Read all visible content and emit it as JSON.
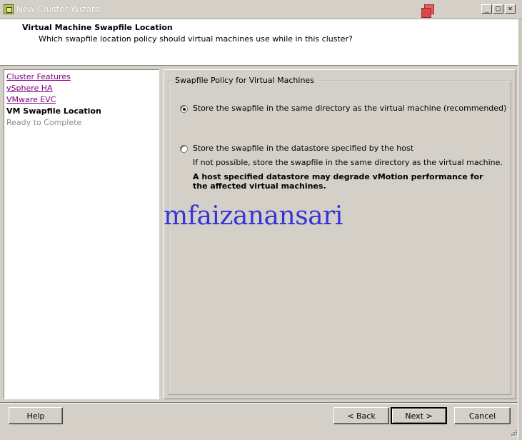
{
  "window": {
    "title": "New Cluster Wizard",
    "controls": {
      "minimize": "_",
      "maximize": "□",
      "close": "×"
    }
  },
  "header": {
    "title": "Virtual Machine Swapfile Location",
    "subtitle": "Which swapfile location policy should virtual machines use while in this cluster?"
  },
  "nav": {
    "items": [
      {
        "label": "Cluster Features",
        "state": "link"
      },
      {
        "label": "vSphere HA",
        "state": "link"
      },
      {
        "label": "VMware EVC",
        "state": "link"
      },
      {
        "label": "VM Swapfile Location",
        "state": "current"
      },
      {
        "label": "Ready to Complete",
        "state": "disabled"
      }
    ]
  },
  "policy": {
    "group_title": "Swapfile Policy for Virtual Machines",
    "options": [
      {
        "label": "Store the swapfile in the same directory as the virtual machine (recommended)",
        "selected": true
      },
      {
        "label": "Store the swapfile in the datastore specified by the host",
        "selected": false,
        "note": "If not possible, store the swapfile in the same directory as the virtual machine.",
        "warning": "A host specified datastore may degrade vMotion performance for the affected virtual machines."
      }
    ]
  },
  "watermark": "mfaizanansari",
  "buttons": {
    "help": "Help",
    "back": "< Back",
    "next": "Next >",
    "cancel": "Cancel"
  },
  "icons": {
    "app": "vsphere-client-icon",
    "restore": "overlapping-windows-icon",
    "radio": "radio-button"
  },
  "colors": {
    "chrome": "#d4d0c8",
    "visited_link": "#800080",
    "watermark": "#3434d8"
  }
}
